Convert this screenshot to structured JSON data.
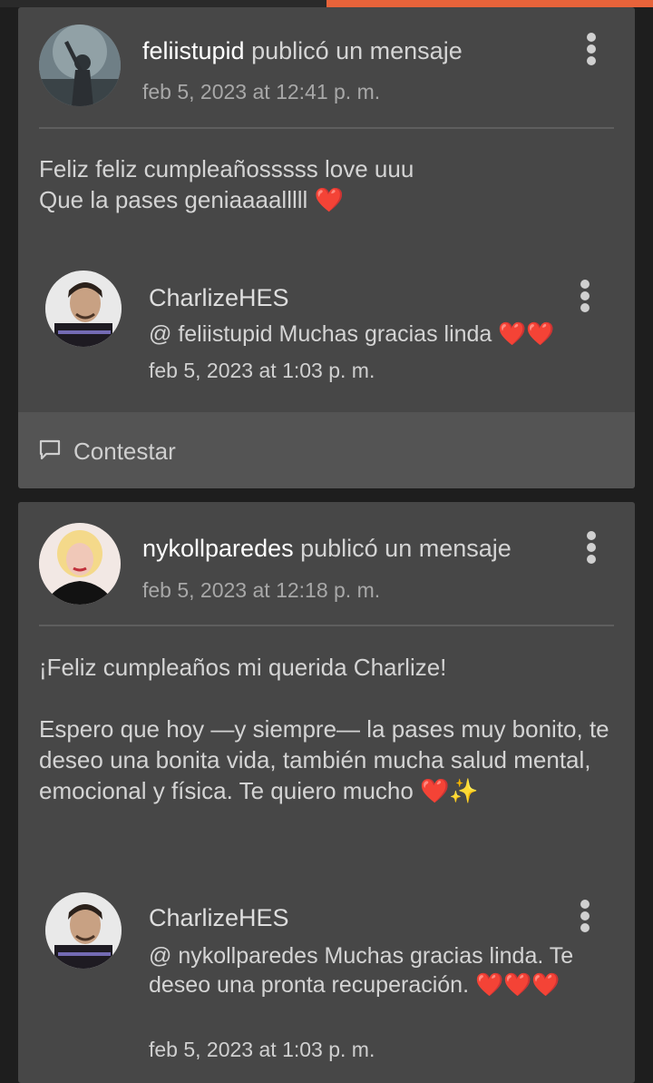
{
  "posts": [
    {
      "username": "feliistupid",
      "action": " publicó un mensaje",
      "timestamp": "feb 5, 2023 at 12:41 p. m.",
      "body": "Feliz feliz cumpleañosssss love uuu\nQue la pases geniaaaalllll ❤️",
      "reply": {
        "name": "CharlizeHES",
        "text": "@ feliistupid  Muchas gracias linda ❤️❤️",
        "timestamp": "feb 5, 2023 at 1:03 p. m."
      },
      "reply_button_label": "Contestar"
    },
    {
      "username": "nykollparedes",
      "action": " publicó un mensaje",
      "timestamp": "feb 5, 2023 at 12:18 p. m.",
      "body": "¡Feliz cumpleaños mi querida Charlize!\n\nEspero que hoy —y siempre— la pases muy bonito, te deseo una bonita vida, también mucha salud mental, emocional y física. Te quiero mucho ❤️✨",
      "reply": {
        "name": "CharlizeHES",
        "text": "@ nykollparedes  Muchas gracias linda. Te deseo una pronta recuperación. ❤️❤️❤️",
        "timestamp": "feb 5, 2023 at 1:03 p. m."
      }
    }
  ],
  "colors": {
    "accent": "#e8633a",
    "card": "#474747",
    "background": "#1e1e1e"
  },
  "icons": {
    "more": "vertical-ellipsis-icon",
    "reply": "speech-bubble-icon"
  }
}
